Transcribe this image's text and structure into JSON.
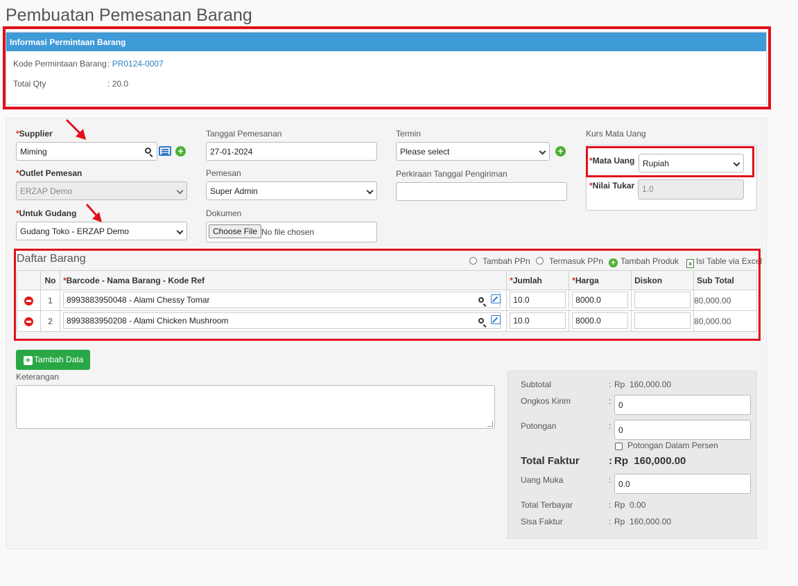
{
  "page": {
    "title": "Pembuatan Pemesanan Barang"
  },
  "info": {
    "header": "Informasi Permintaan Barang",
    "kode_label": "Kode Permintaan Barang",
    "kode_colon": ":",
    "kode_value": "PR0124-0007",
    "qty_label": "Total Qty",
    "qty_colon": ":",
    "qty_value": "20.0"
  },
  "form": {
    "supplier": {
      "star": "*",
      "label": "Supplier",
      "value": "Miming"
    },
    "outlet": {
      "star": "*",
      "label": "Outlet Pemesan",
      "value": "ERZAP Demo"
    },
    "gudang": {
      "star": "*",
      "label": "Untuk Gudang",
      "value": "Gudang Toko - ERZAP Demo"
    },
    "tanggal": {
      "label": "Tanggal Pemesanan",
      "value": "27-01-2024"
    },
    "pemesan": {
      "label": "Pemesan",
      "value": "Super Admin"
    },
    "dokumen": {
      "label": "Dokumen",
      "button": "Choose File",
      "status": "No file chosen"
    },
    "termin": {
      "label": "Termin",
      "value": "Please select"
    },
    "perkiraan": {
      "label": "Perkiraan Tanggal Pengiriman",
      "value": ""
    },
    "kurs": {
      "label": "Kurs Mata Uang",
      "mata_uang_star": "*",
      "mata_uang_label": "Mata Uang",
      "mata_uang_value": "Rupiah",
      "nilai_tukar_star": "*",
      "nilai_tukar_label": "Nilai Tukar",
      "nilai_tukar_value": "1.0"
    }
  },
  "items_section": {
    "title": "Daftar Barang",
    "toolbar": {
      "tambah_ppn": "Tambah PPn",
      "termasuk_ppn": "Termasuk PPn",
      "tambah_produk": "Tambah Produk",
      "isi_excel": "Isi Table via Excel"
    },
    "columns": {
      "no": "No",
      "barcode_star": "*",
      "barcode": "Barcode - Nama Barang - Kode Ref",
      "jumlah_star": "*",
      "jumlah": "Jumlah",
      "harga_star": "*",
      "harga": "Harga",
      "diskon": "Diskon",
      "subtotal": "Sub Total"
    },
    "rows": [
      {
        "no": "1",
        "product": "8993883950048 - Alami Chessy Tomar",
        "jumlah": "10.0",
        "harga": "8000.0",
        "diskon": "",
        "subtotal": "80,000.00"
      },
      {
        "no": "2",
        "product": "8993883950208 - Alami Chicken Mushroom",
        "jumlah": "10.0",
        "harga": "8000.0",
        "diskon": "",
        "subtotal": "80,000.00"
      }
    ],
    "add_button": "Tambah Data"
  },
  "notes": {
    "label": "Keterangan",
    "value": ""
  },
  "summary": {
    "subtotal_label": "Subtotal",
    "subtotal_value": "Rp  160,000.00",
    "ongkos_label": "Ongkos Kirim",
    "ongkos_value": "0",
    "potongan_label": "Potongan",
    "potongan_value": "0",
    "potongan_persen_label": "Potongan Dalam Persen",
    "total_faktur_label": "Total Faktur",
    "total_faktur_value": "Rp  160,000.00",
    "uang_muka_label": "Uang Muka",
    "uang_muka_value": "0.0",
    "total_terbayar_label": "Total Terbayar",
    "total_terbayar_value": "Rp  0.00",
    "sisa_faktur_label": "Sisa Faktur",
    "sisa_faktur_value": "Rp  160,000.00",
    "colon": ":"
  },
  "colors": {
    "header_blue": "#3f9ad8",
    "highlight_red": "#e0101c",
    "add_green": "#29a745",
    "link_blue": "#2a83c6"
  }
}
